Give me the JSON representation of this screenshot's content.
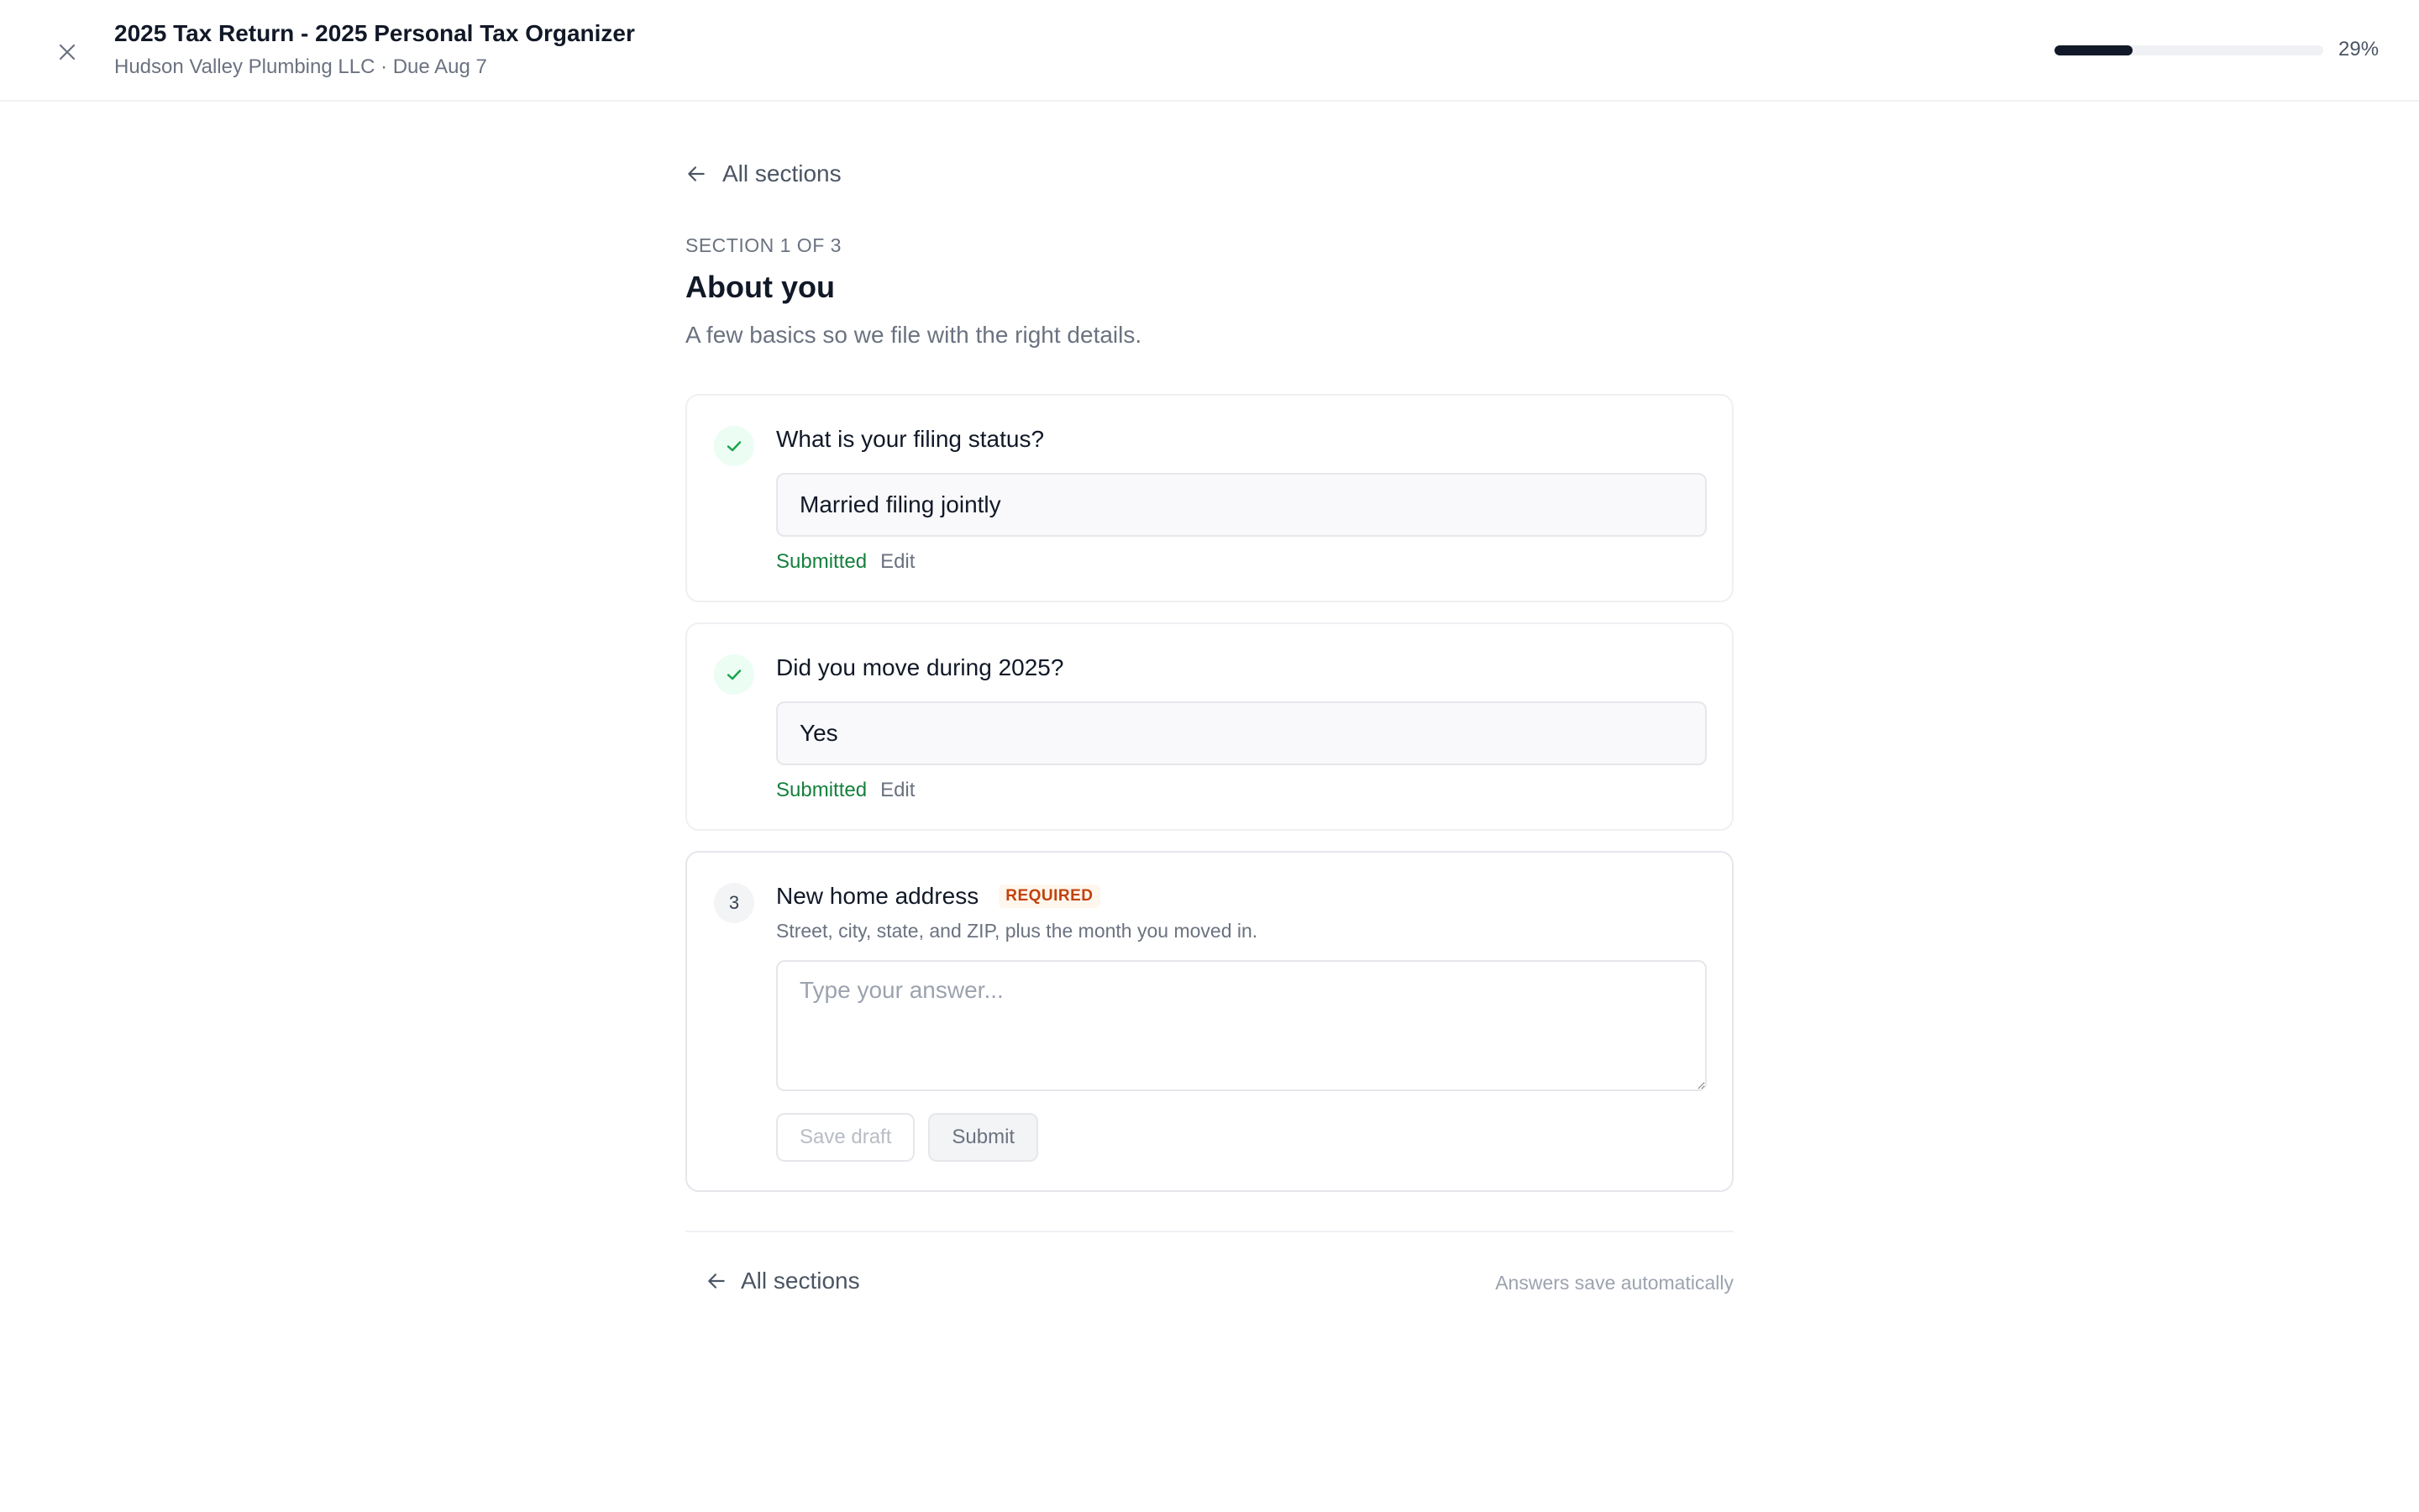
{
  "header": {
    "title": "2025 Tax Return - 2025 Personal Tax Organizer",
    "subtitle": "Hudson Valley Plumbing LLC · Due Aug 7",
    "progress_percent": 29,
    "progress_label": "29%",
    "close_icon": "close-icon"
  },
  "nav": {
    "back_label": "All sections",
    "back_icon": "arrow-left-icon"
  },
  "section": {
    "counter": "SECTION 1 OF 3",
    "title": "About you",
    "description": "A few basics so we file with the right details."
  },
  "questions": [
    {
      "text": "What is your filing status?",
      "answer": "Married filing jointly",
      "status_label": "Submitted",
      "edit_label": "Edit",
      "icon": "check-icon"
    },
    {
      "text": "Did you move during 2025?",
      "answer": "Yes",
      "status_label": "Submitted",
      "edit_label": "Edit",
      "icon": "check-icon"
    },
    {
      "number": "3",
      "text": "New home address",
      "badge": "REQUIRED",
      "help": "Street, city, state, and ZIP, plus the month you moved in.",
      "placeholder": "Type your answer...",
      "save_draft_label": "Save draft",
      "submit_label": "Submit"
    }
  ],
  "footer": {
    "back_label": "All sections",
    "note": "Answers save automatically"
  },
  "colors": {
    "accent_dark": "#111827",
    "success": "#15803d",
    "required": "#c2410c"
  }
}
